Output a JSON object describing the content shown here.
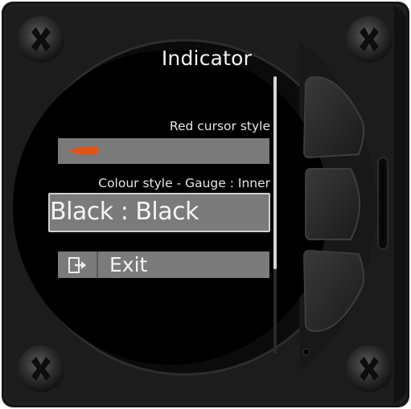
{
  "screen": {
    "title": "Indicator",
    "cursor_setting": {
      "label": "Red cursor style",
      "marker_color": "#e0541a"
    },
    "colour_setting": {
      "label": "Colour style - Gauge : Inner",
      "value": "Black : Black"
    },
    "exit": {
      "label": "Exit",
      "icon": "exit-door-icon"
    }
  },
  "colors": {
    "bezel": "#141414",
    "screen_bg": "#000000",
    "row_bg": "#7b7b7b",
    "text": "#f2f2f2",
    "accent_cursor": "#e0541a"
  },
  "hardware": {
    "buttons": [
      "upper-soft-button",
      "middle-soft-button",
      "lower-soft-button"
    ],
    "screws": 4
  }
}
